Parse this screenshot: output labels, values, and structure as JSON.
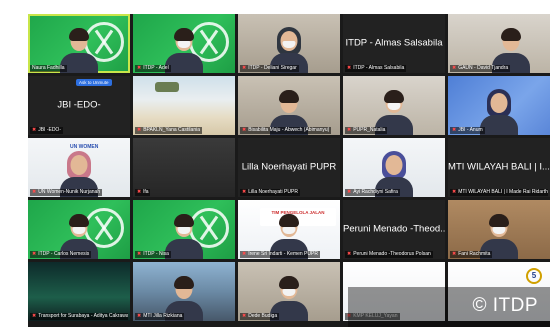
{
  "meeting": {
    "unmute_label": "Ask to Unmute",
    "copyright": "© ITDP"
  },
  "tiles": [
    {
      "name": "Naura Fadhilla",
      "bg": "bg-itdp",
      "logo": true,
      "person": "hair",
      "active": true,
      "muted": false
    },
    {
      "name": "ITDP - Adel",
      "bg": "bg-itdp",
      "logo": true,
      "person": "hair-mask",
      "muted": true
    },
    {
      "name": "ITDP - Deliani Siregar",
      "bg": "bg-room",
      "person": "hijab-mask",
      "hijab_color": "#2f3640",
      "muted": true
    },
    {
      "name": "ITDP - Almas Salsabila",
      "center_text": "ITDP - Almas Salsabila",
      "muted": true
    },
    {
      "name": "GAUN - David Tjandra",
      "bg": "bg-office",
      "person": "hair",
      "shift": "shift-right",
      "muted": true
    },
    {
      "name": "JBI -EDO-",
      "center_text": "JBI -EDO-",
      "muted": true,
      "unmute": true
    },
    {
      "name": "BPAKLN_Yana Castilania",
      "bg": "bg-beach",
      "palm": true,
      "muted": true
    },
    {
      "name": "Bisabilita Maju - Abwech (Abimanyu)",
      "bg": "bg-room",
      "person": "hair",
      "muted": true
    },
    {
      "name": "PUPR_Natalia",
      "bg": "bg-office",
      "person": "hair-mask",
      "muted": true
    },
    {
      "name": "JBI - Anum",
      "bg": "bg-blue",
      "person": "hijab",
      "hijab_color": "#2b2f55",
      "muted": true
    },
    {
      "name": "UN Women-Nunik Nurjanah",
      "bg": "bg-white",
      "person": "hijab",
      "hijab_color": "#c9788a",
      "slide_text": "UN WOMEN",
      "muted": true
    },
    {
      "name": "lfa",
      "bg": "bg-dark",
      "muted": true
    },
    {
      "name": "Lilla Noerhayati PUPR",
      "center_text": "Lilla Noerhayati PUPR",
      "muted": true
    },
    {
      "name": "Ayi Rachdiyni Safira",
      "bg": "bg-white",
      "person": "hijab",
      "hijab_color": "#4a4f9a",
      "muted": true
    },
    {
      "name": "MTI WILAYAH BALI | I Made Rai Ridartha",
      "center_text": "MTI WILAYAH BALI | I...",
      "muted": true
    },
    {
      "name": "ITDP - Carlos Nemesis",
      "bg": "bg-itdp",
      "logo": true,
      "person": "hair-mask",
      "muted": true
    },
    {
      "name": "ITDP - Nisa",
      "bg": "bg-itdp",
      "logo": true,
      "person": "hair-mask",
      "muted": true
    },
    {
      "name": "Irene Sri Indarti - Kemen PUPR",
      "bg": "bg-slide",
      "person": "hair-mask",
      "banner": "TIM PENGELOLA JALAN",
      "muted": true
    },
    {
      "name": "Peruni Menado -Theodorus Polsan",
      "center_text": "Peruni Menado -Theod...",
      "muted": true
    },
    {
      "name": "Fani Rachmita",
      "bg": "bg-wood",
      "person": "hair-mask",
      "muted": true
    },
    {
      "name": "Transport for Surabaya - Aditya Cakrawala",
      "bg": "bg-aurora",
      "muted": true
    },
    {
      "name": "MTI Jilla Rizkiana",
      "bg": "bg-city",
      "person": "hair",
      "muted": true
    },
    {
      "name": "Dede Budiga",
      "bg": "bg-room",
      "person": "hair-mask",
      "muted": true
    },
    {
      "name": "KMP KELUJ_Yayan",
      "bg": "bg-slide",
      "slide_text": "",
      "muted": true
    },
    {
      "name": "",
      "bg": "bg-slide",
      "logo5": true,
      "muted": false
    }
  ]
}
